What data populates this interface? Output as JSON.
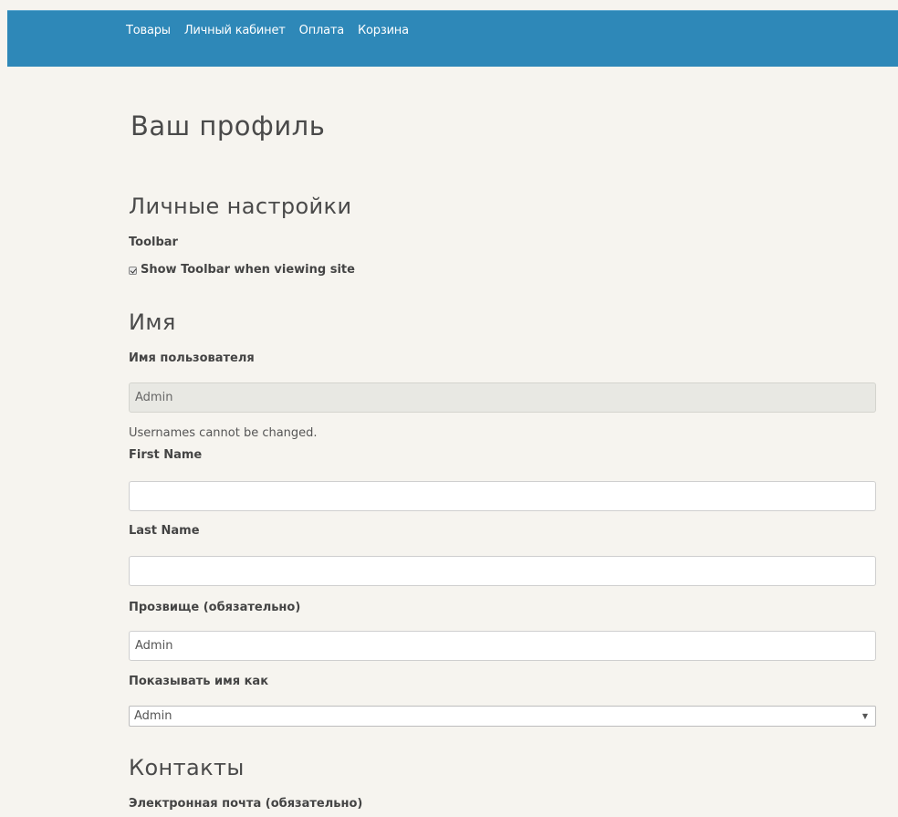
{
  "nav": {
    "items": [
      "Товары",
      "Личный кабинет",
      "Оплата",
      "Корзина"
    ]
  },
  "page": {
    "title": "Ваш профиль"
  },
  "personal": {
    "section_title": "Личные настройки",
    "toolbar_label": "Toolbar",
    "toolbar_checkbox_label": "Show Toolbar when viewing site",
    "toolbar_checked": true
  },
  "name": {
    "section_title": "Имя",
    "username_label": "Имя пользователя",
    "username_value": "Admin",
    "username_hint": "Usernames cannot be changed.",
    "first_name_label": "First Name",
    "first_name_value": "",
    "last_name_label": "Last Name",
    "last_name_value": "",
    "nickname_label": "Прозвище (обязательно)",
    "nickname_value": "Admin",
    "display_name_label": "Показывать имя как",
    "display_name_value": "Admin"
  },
  "contacts": {
    "section_title": "Контакты",
    "email_label": "Электронная почта (обязательно)"
  },
  "colors": {
    "header_bg": "#2e88b8",
    "page_bg": "#f6f4ef"
  }
}
